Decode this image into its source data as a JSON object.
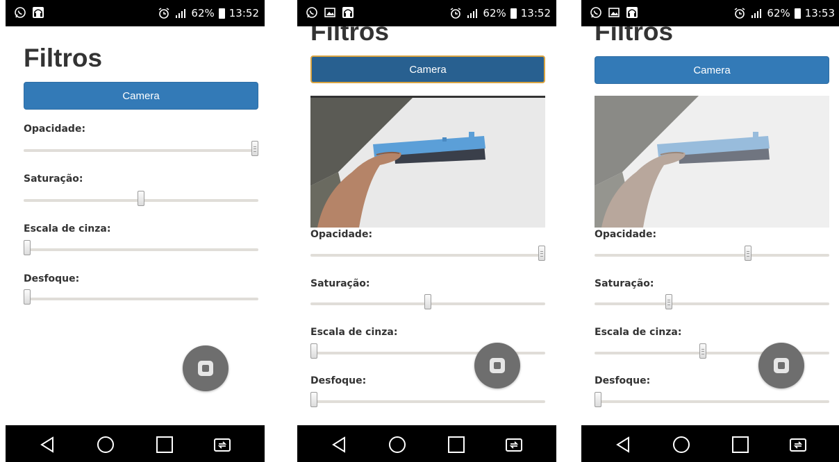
{
  "phones": [
    {
      "status_time": "13:52",
      "battery": "62%",
      "has_gallery_icon": false,
      "title": "Filtros",
      "camera_label": "Camera",
      "camera_focused": false,
      "has_preview": false,
      "sliders": [
        {
          "label": "Opacidade:",
          "value": 1.0
        },
        {
          "label": "Saturação:",
          "value": 0.5
        },
        {
          "label": "Escala de cinza:",
          "value": 0.0
        },
        {
          "label": "Desfoque:",
          "value": 0.0
        }
      ]
    },
    {
      "status_time": "13:52",
      "battery": "62%",
      "has_gallery_icon": true,
      "title": "Filtros",
      "camera_label": "Camera",
      "camera_focused": true,
      "has_preview": true,
      "sliders": [
        {
          "label": "Opacidade:",
          "value": 1.0
        },
        {
          "label": "Saturação:",
          "value": 0.5
        },
        {
          "label": "Escala de cinza:",
          "value": 0.0
        },
        {
          "label": "Desfoque:",
          "value": 0.0
        }
      ]
    },
    {
      "status_time": "13:53",
      "battery": "62%",
      "has_gallery_icon": true,
      "title": "Filtros",
      "camera_label": "Camera",
      "camera_focused": false,
      "has_preview": true,
      "sliders": [
        {
          "label": "Opacidade:",
          "value": 0.66
        },
        {
          "label": "Saturação:",
          "value": 0.31
        },
        {
          "label": "Escala de cinza:",
          "value": 0.46
        },
        {
          "label": "Desfoque:",
          "value": 0.0
        }
      ]
    }
  ],
  "icons": {
    "status_left": [
      "whatsapp-icon",
      "headset-icon"
    ],
    "status_right": [
      "alarm-icon",
      "signal-icon",
      "battery-icon"
    ],
    "fab": "stop-icon",
    "nav": [
      "back-icon",
      "home-icon",
      "recents-icon",
      "quick-switch-icon"
    ]
  },
  "colors": {
    "primary_button": "#337ab7",
    "primary_button_focused": "#286090",
    "focus_ring": "#d9a441",
    "fab": "#6e6e6e",
    "bars": "#000000"
  }
}
